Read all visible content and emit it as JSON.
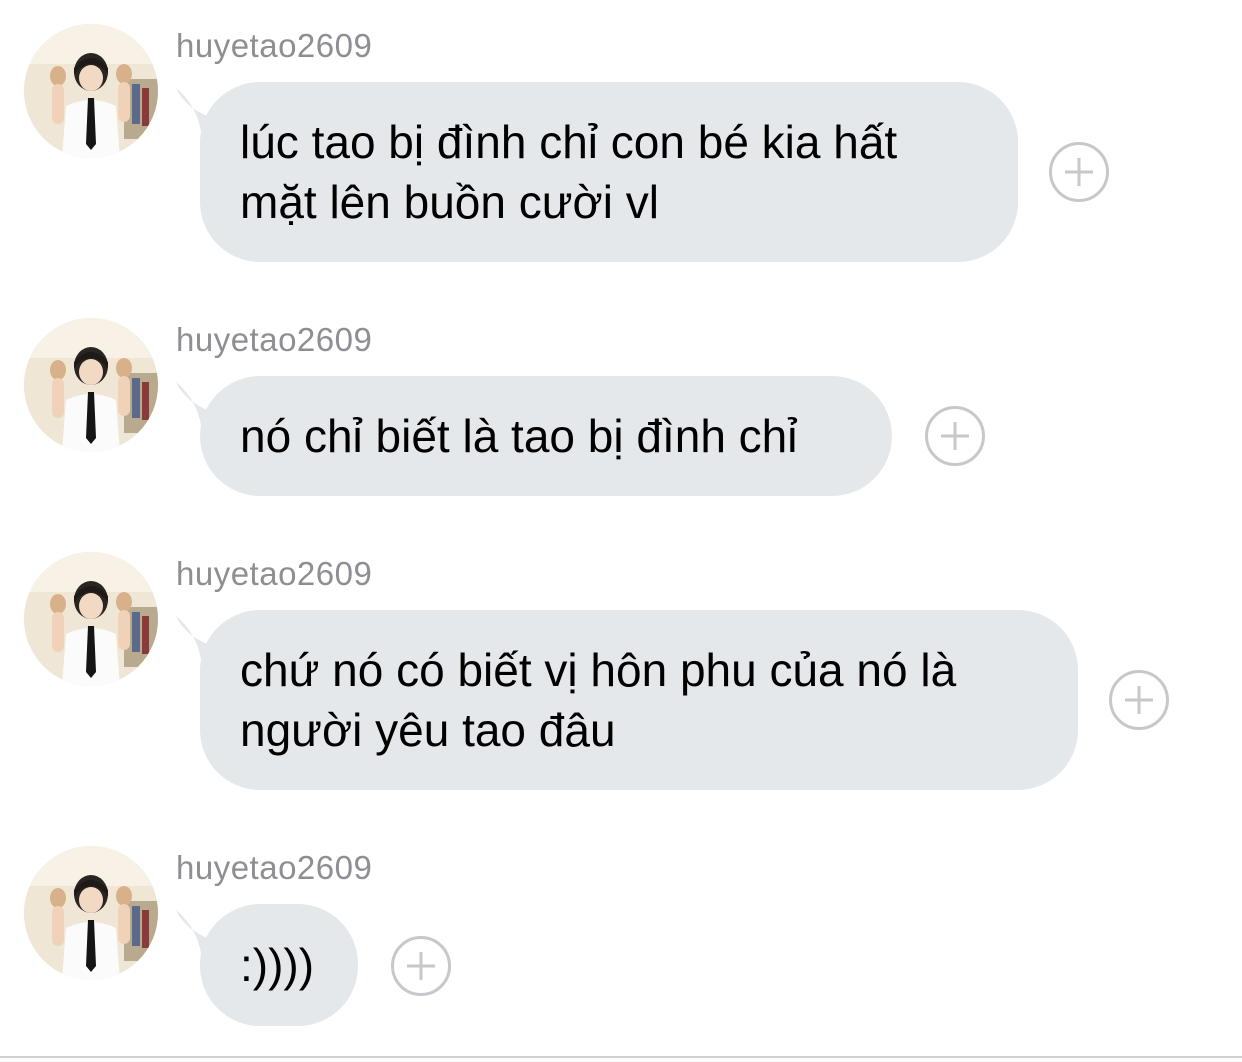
{
  "messages": [
    {
      "username": "huyetao2609",
      "text": "lúc tao bị đình chỉ con bé kia hất\nmặt lên buồn cười vl",
      "avatar_icon": "user-avatar-photo",
      "react_icon": "plus-icon"
    },
    {
      "username": "huyetao2609",
      "text": "nó chỉ biết là tao bị đình chỉ",
      "avatar_icon": "user-avatar-photo",
      "react_icon": "plus-icon"
    },
    {
      "username": "huyetao2609",
      "text": "chứ nó có biết vị hôn phu của nó là\nngười yêu tao đâu",
      "avatar_icon": "user-avatar-photo",
      "react_icon": "plus-icon"
    },
    {
      "username": "huyetao2609",
      "text": ":))))",
      "avatar_icon": "user-avatar-photo",
      "react_icon": "plus-icon"
    }
  ],
  "colors": {
    "bubble": "#e5e8eb",
    "username": "#8e8e93",
    "react_border": "#c7c7cc",
    "text": "#000000"
  }
}
